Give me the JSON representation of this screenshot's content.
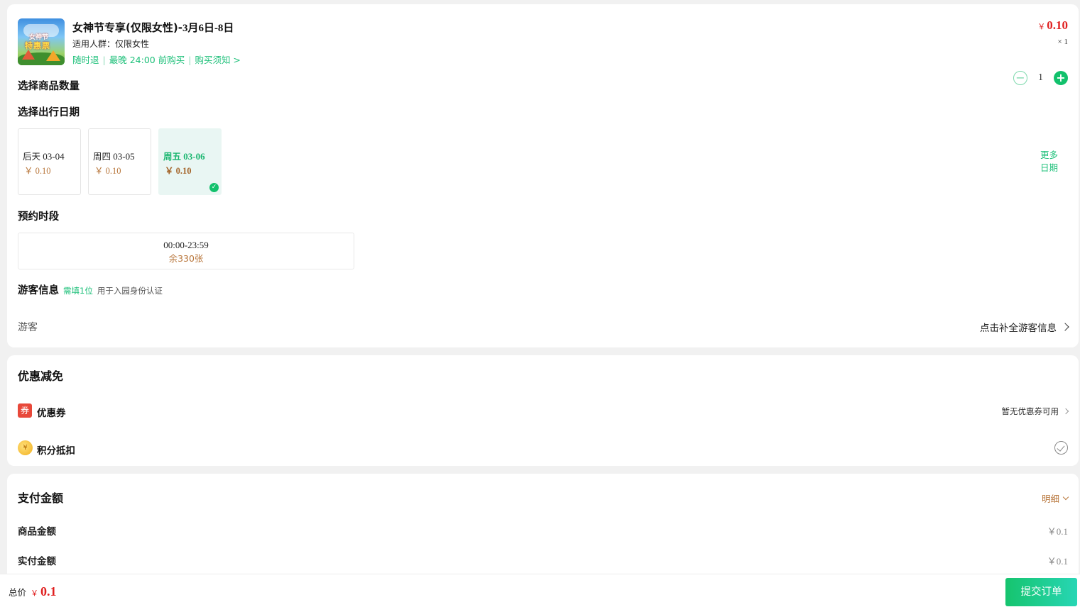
{
  "product": {
    "title_prefix": "女神节专享(仅限女性)-",
    "title_dates": "3月6日-8日",
    "crowd": "适用人群：仅限女性",
    "tags": [
      "随时退",
      "最晚 24:00 前购买",
      "购买须知 >"
    ],
    "price_symbol": "￥",
    "price": "0.10",
    "quantity_text": "× 1",
    "thumb_text1": "女神节",
    "thumb_text2": "特惠票"
  },
  "quantity": {
    "label": "选择商品数量",
    "value": "1",
    "minus": "−",
    "plus": "+"
  },
  "date_select": {
    "label": "选择出行日期",
    "options": [
      {
        "weekday": "后天",
        "date": "03-04",
        "price": "￥ 0.10",
        "selected": false
      },
      {
        "weekday": "周四",
        "date": "03-05",
        "price": "￥ 0.10",
        "selected": false
      },
      {
        "weekday": "周五",
        "date": "03-06",
        "price": "￥ 0.10",
        "selected": true
      }
    ],
    "more": "更多日期"
  },
  "time_slot": {
    "label": "预约时段",
    "time": "00:00-23:59",
    "remaining": "余330张"
  },
  "visitor": {
    "label": "游客信息",
    "required": "需填1位",
    "hint": "用于入园身份认证",
    "row_label": "游客",
    "action": "点击补全游客信息"
  },
  "discount": {
    "title": "优惠减免",
    "coupon_badge": "券",
    "coupon_label": "优惠券",
    "coupon_status": "暂无优惠券可用",
    "points_icon": "¥",
    "points_label": "积分抵扣"
  },
  "payment": {
    "title": "支付金额",
    "detail": "明细",
    "rows": [
      {
        "label": "商品金额",
        "value": "￥0.1"
      },
      {
        "label": "实付金额",
        "value": "￥0.1"
      }
    ]
  },
  "footer": {
    "total_label": "总价",
    "currency": "￥",
    "total": "0.1",
    "submit": "提交订单"
  },
  "colors": {
    "accent_green": "#12c16c",
    "price_red": "#e02020",
    "price_brown": "#b8763b"
  }
}
